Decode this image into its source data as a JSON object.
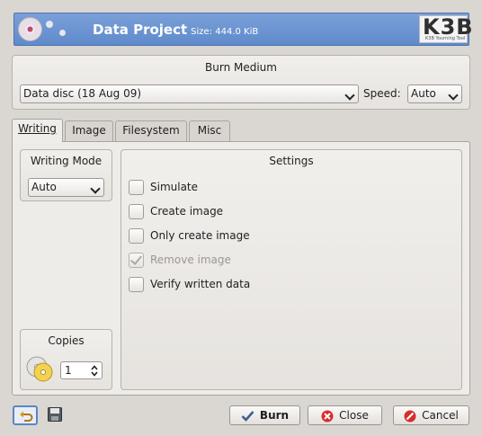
{
  "header": {
    "title": "Data Project",
    "size": "Size: 444.0 KiB",
    "logo_text": "K3B",
    "logo_tagline": "K3B Yourning Tool"
  },
  "burn_medium": {
    "title": "Burn Medium",
    "device": "Data disc (18 Aug 09)",
    "speed_label": "Speed:",
    "speed_value": "Auto"
  },
  "tabs": [
    {
      "label": "Writing",
      "active": true
    },
    {
      "label": "Image",
      "active": false
    },
    {
      "label": "Filesystem",
      "active": false
    },
    {
      "label": "Misc",
      "active": false
    }
  ],
  "writing_mode": {
    "title": "Writing Mode",
    "value": "Auto"
  },
  "settings": {
    "title": "Settings",
    "options": [
      {
        "label": "Simulate",
        "checked": false,
        "enabled": true
      },
      {
        "label": "Create image",
        "checked": false,
        "enabled": true
      },
      {
        "label": "Only create image",
        "checked": false,
        "enabled": true
      },
      {
        "label": "Remove image",
        "checked": true,
        "enabled": false
      },
      {
        "label": "Verify written data",
        "checked": false,
        "enabled": true
      }
    ]
  },
  "copies": {
    "title": "Copies",
    "value": "1"
  },
  "buttons": {
    "burn": "Burn",
    "close": "Close",
    "cancel": "Cancel"
  },
  "icons": {
    "load_settings": "undo-arrow-icon",
    "save_settings": "floppy-disk-icon",
    "burn": "checkmark-icon",
    "close": "close-icon",
    "cancel": "cancel-icon"
  }
}
